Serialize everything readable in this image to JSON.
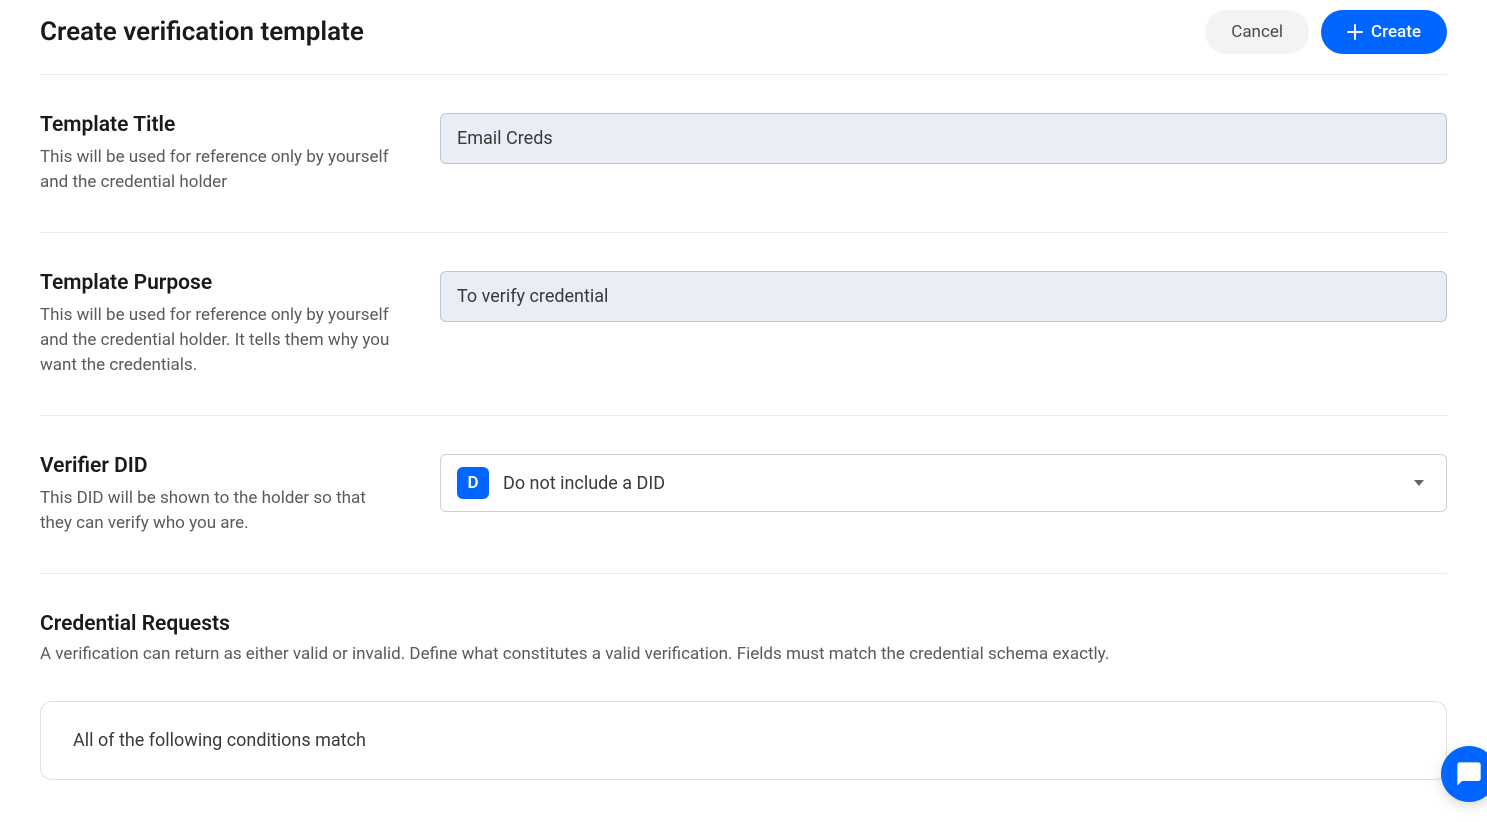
{
  "header": {
    "title": "Create verification template",
    "cancel_label": "Cancel",
    "create_label": "Create"
  },
  "sections": {
    "title": {
      "label": "Template Title",
      "description": "This will be used for reference only by yourself and the credential holder",
      "value": "Email Creds"
    },
    "purpose": {
      "label": "Template Purpose",
      "description": "This will be used for reference only by yourself and the credential holder. It tells them why you want the credentials.",
      "value": "To verify credential"
    },
    "verifier_did": {
      "label": "Verifier DID",
      "description": "This DID will be shown to the holder so that they can verify who you are.",
      "badge_letter": "D",
      "selected": "Do not include a DID"
    },
    "credential_requests": {
      "label": "Credential Requests",
      "description": "A verification can return as either valid or invalid. Define what constitutes a valid verification. Fields must match the credential schema exactly.",
      "conditions_label": "All of the following conditions match"
    }
  }
}
